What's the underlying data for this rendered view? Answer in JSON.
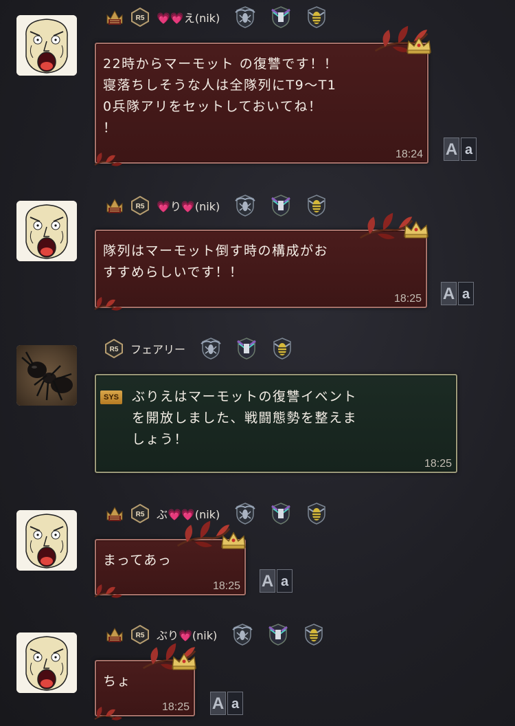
{
  "messages": [
    {
      "avatar": "screaming-face-avatar",
      "name": "💗💗え(nik)",
      "rank": "R5",
      "text": "22時からマーモット の復讐です！！\n寝落ちしそうな人は全隊列にT9〜T1\n0兵隊アリをセットしておいてね！\n！",
      "time": "18:24",
      "translate_a": "A",
      "translate_b": "a"
    },
    {
      "avatar": "screaming-face-avatar",
      "name": "💗り💗(nik)",
      "rank": "R5",
      "text": "隊列はマーモット倒す時の構成がお\nすすめらしいです！！",
      "time": "18:25",
      "translate_a": "A",
      "translate_b": "a"
    },
    {
      "avatar": "ant-avatar",
      "name": "フェアリー",
      "rank": "R5",
      "sys_tag": "SYS",
      "text": "ぶりえはマーモットの復讐イベント\nを開放しました、戦闘態勢を整えま\nしょう！",
      "time": "18:25"
    },
    {
      "avatar": "screaming-face-avatar",
      "name": "ぶ💗💗(nik)",
      "rank": "R5",
      "text": "まってあっ",
      "time": "18:25",
      "translate_a": "A",
      "translate_b": "a"
    },
    {
      "avatar": "screaming-face-avatar",
      "name": "ぶり💗(nik)",
      "rank": "R5",
      "text": "ちょ",
      "time": "18:25",
      "translate_a": "A",
      "translate_b": "a"
    }
  ],
  "colors": {
    "background": "#1f1f25",
    "bubble_red": "#3d1616",
    "bubble_border": "#a8726a",
    "bubble_sys": "#16231d",
    "heart": "#ff4fb0"
  }
}
